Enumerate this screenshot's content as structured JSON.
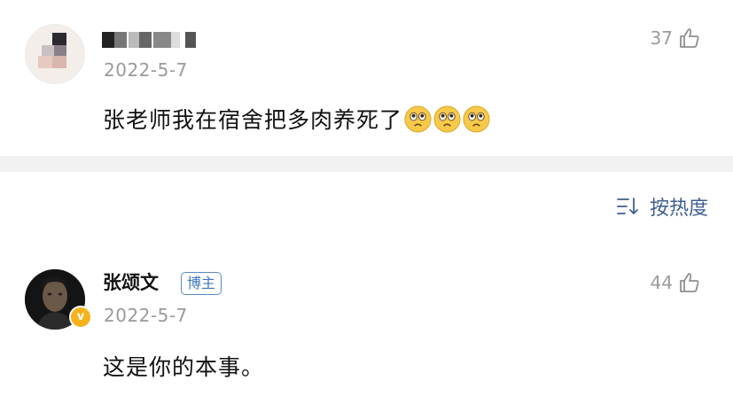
{
  "comments": [
    {
      "username": "",
      "date": "2022-5-7",
      "text": "张老师我在宿舍把多肉养死了",
      "likes": "37",
      "emojis": [
        "crying-face",
        "crying-face",
        "crying-face"
      ]
    },
    {
      "username": "张颂文",
      "badge": "博主",
      "date": "2022-5-7",
      "text": "这是你的本事。",
      "likes": "44",
      "verified": true
    }
  ],
  "sort": {
    "label": "按热度"
  },
  "colors": {
    "link": "#3f5f8f",
    "badge": "#3f76bf",
    "verified": "#f6b21b",
    "muted": "#9a9a9a"
  }
}
